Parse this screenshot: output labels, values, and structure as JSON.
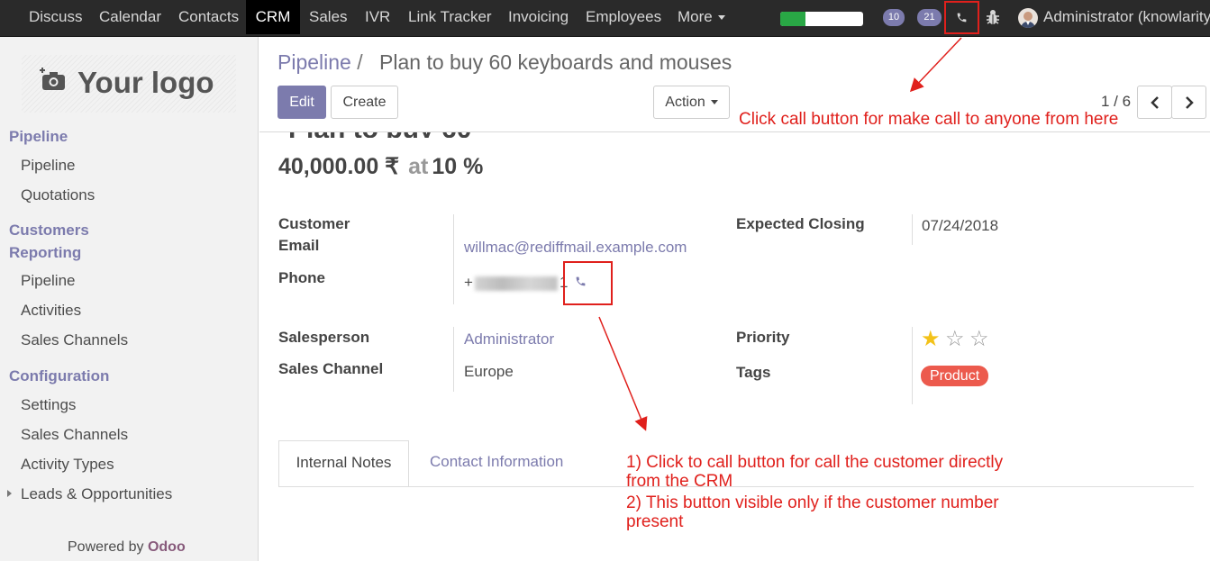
{
  "topbar": {
    "menu": [
      "Discuss",
      "Calendar",
      "Contacts",
      "CRM",
      "Sales",
      "IVR",
      "Link Tracker",
      "Invoicing",
      "Employees",
      "More"
    ],
    "active": "CRM",
    "progress": 0.3,
    "badge_activity": "10",
    "badge_messages": "21",
    "user": "Administrator (knowlarity"
  },
  "sidebar": {
    "logo_text": "Your logo",
    "pipeline_header": "Pipeline",
    "pipeline_items": [
      "Pipeline",
      "Quotations"
    ],
    "customers": "Customers",
    "reporting_header": "Reporting",
    "reporting_items": [
      "Pipeline",
      "Activities",
      "Sales Channels"
    ],
    "configuration_header": "Configuration",
    "configuration_items": [
      "Settings",
      "Sales Channels",
      "Activity Types",
      "Leads & Opportunities"
    ],
    "powered_by": "Powered by",
    "powered_brand": "Odoo"
  },
  "breadcrumb": {
    "parent": "Pipeline",
    "separator": "/",
    "current": "Plan to buy 60 keyboards and mouses"
  },
  "buttons": {
    "edit": "Edit",
    "create": "Create",
    "action": "Action"
  },
  "pager": "1 / 6",
  "record": {
    "revenue": "40,000.00 ₹",
    "at": "at",
    "probability": "10 %",
    "labels": {
      "customer": "Customer",
      "email": "Email",
      "phone": "Phone",
      "salesperson": "Salesperson",
      "sales_channel": "Sales Channel",
      "expected_closing": "Expected Closing",
      "priority": "Priority",
      "tags": "Tags"
    },
    "email": "willmac@rediffmail.example.com",
    "phone_prefix": "+",
    "phone_suffix": "1",
    "salesperson": "Administrator",
    "sales_channel": "Europe",
    "expected_closing": "07/24/2018",
    "priority_stars": 1,
    "priority_max": 3,
    "tag": "Product"
  },
  "tabs": [
    "Internal Notes",
    "Contact Information"
  ],
  "annotations": {
    "top": "Click call button for make call to anyone from here",
    "note1_line1": "1) Click to call button for call the customer directly",
    "note1_line2": "from the CRM",
    "note2_line1": "2) This button visible only if the customer number",
    "note2_line2": "present"
  },
  "colors": {
    "accent": "#7c7bad",
    "annotation": "#e0201c",
    "tag": "#ec5a4d",
    "star": "#f3c219"
  }
}
